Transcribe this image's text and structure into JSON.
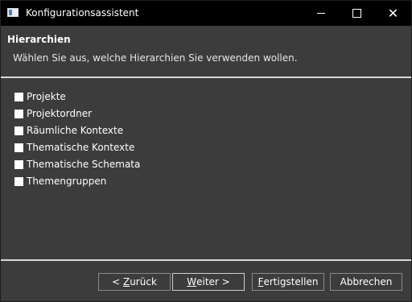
{
  "window": {
    "title": "Konfigurationsassistent"
  },
  "header": {
    "title": "Hierarchien",
    "subtitle": "Wählen Sie aus, welche Hierarchien Sie verwenden wollen."
  },
  "options": [
    {
      "label": "Projekte",
      "checked": false
    },
    {
      "label": "Projektordner",
      "checked": false
    },
    {
      "label": "Räumliche Kontexte",
      "checked": false
    },
    {
      "label": "Thematische Kontexte",
      "checked": false
    },
    {
      "label": "Thematische Schemata",
      "checked": false
    },
    {
      "label": "Themengruppen",
      "checked": false
    }
  ],
  "buttons": {
    "back": {
      "prefix": "< ",
      "mnemonic": "Z",
      "rest": "urück"
    },
    "next": {
      "mnemonic": "W",
      "rest": "eiter >"
    },
    "finish": {
      "mnemonic": "F",
      "rest": "ertigstellen"
    },
    "cancel": {
      "label": "Abbrechen"
    }
  },
  "colors": {
    "titlebar": "#000000",
    "background": "#3c3c3c",
    "text": "#ffffff"
  }
}
